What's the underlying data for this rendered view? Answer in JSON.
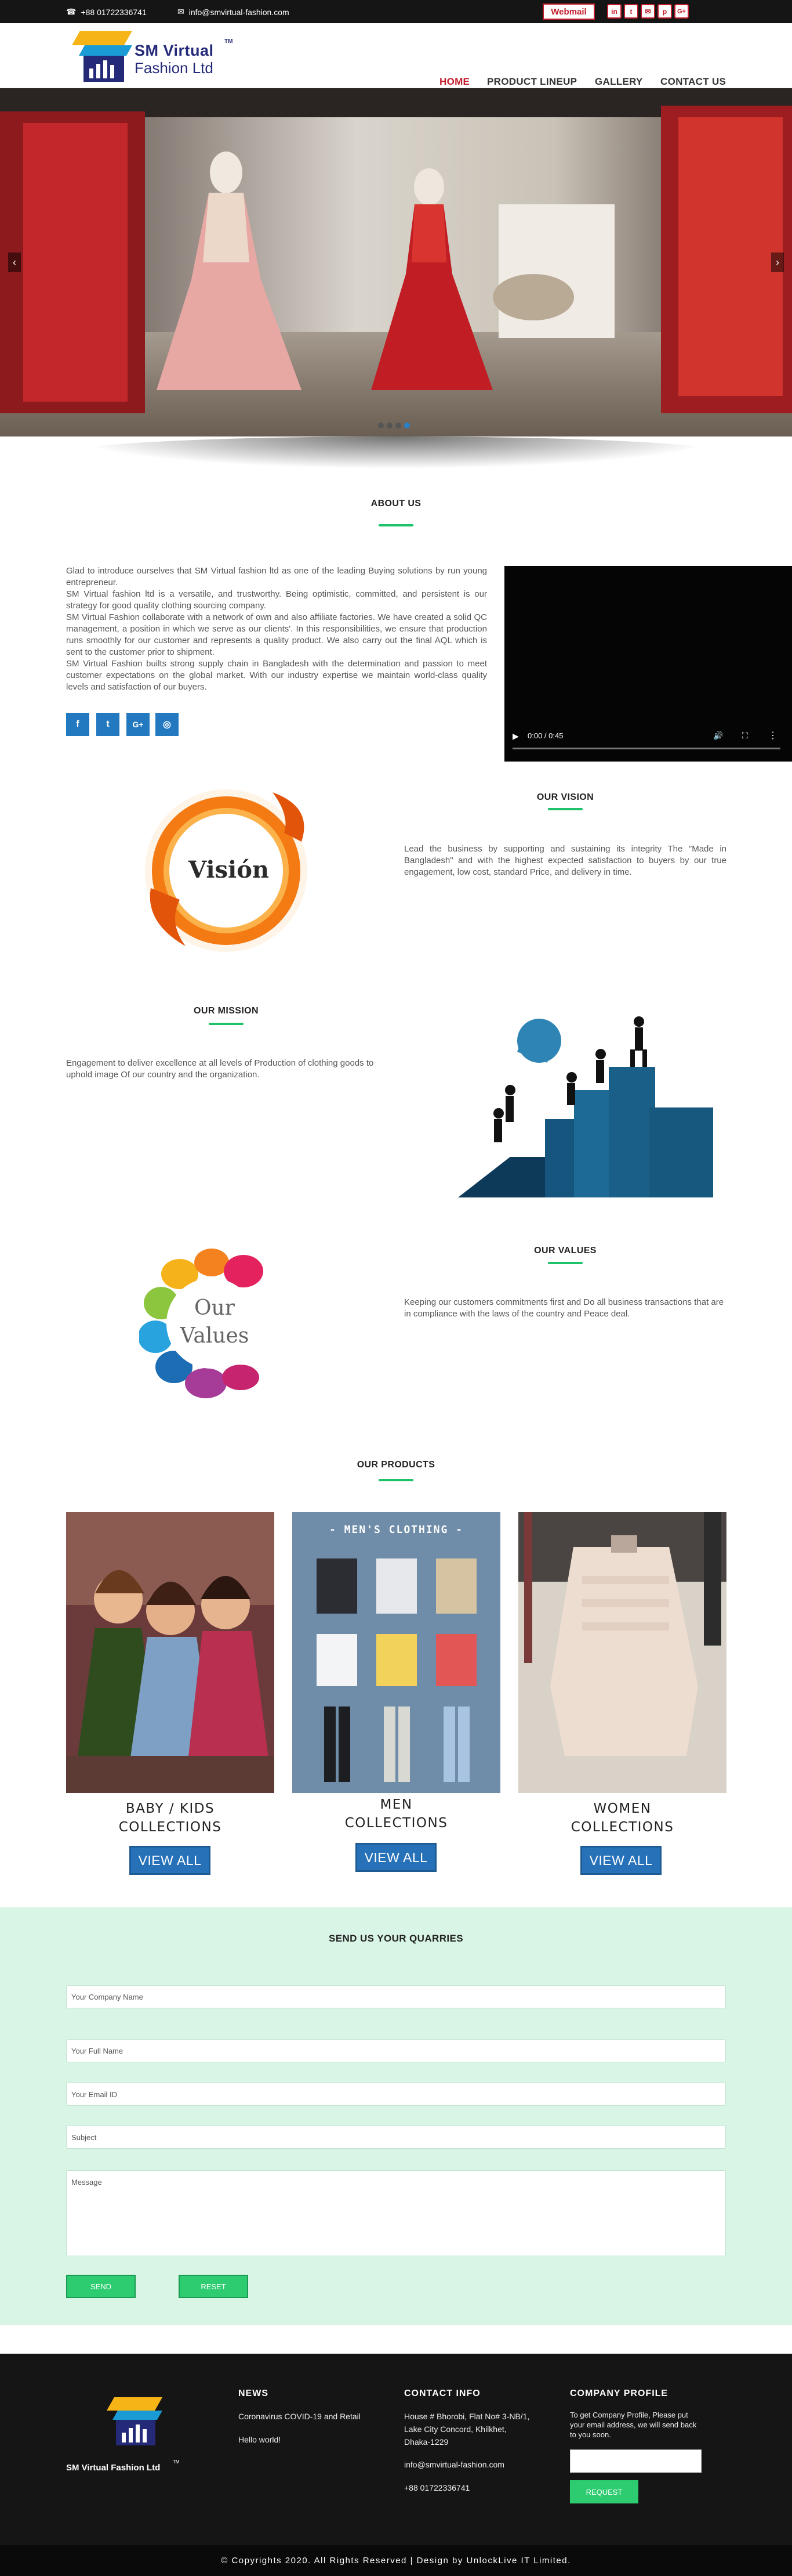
{
  "topbar": {
    "phone": "+88 01722336741",
    "email": "info@smvirtual-fashion.com",
    "webmail": "Webmail",
    "social": [
      "in",
      "t",
      "✉",
      "p",
      "G+"
    ]
  },
  "brand": {
    "name_line1": "SM Virtual",
    "name_line2": "Fashion Ltd",
    "tm": "TM"
  },
  "nav": [
    "HOME",
    "PRODUCT LINEUP",
    "GALLERY",
    "CONTACT US"
  ],
  "hero": {
    "dots": 4,
    "active_dot": 3
  },
  "about": {
    "title": "ABOUT US",
    "paragraphs": [
      "Glad to introduce ourselves  that SM Virtual fashion ltd as one of the leading Buying solutions by run young entrepreneur.",
      "SM Virtual fashion ltd is a versatile, and trustworthy. Being optimistic, committed, and persistent is our strategy for good quality clothing sourcing company.",
      "SM Virtual Fashion collaborate with a network of own and also affiliate factories. We have created a solid QC management, a position in which we serve as our clients'. In this responsibilities, we ensure that production runs smoothly for our customer and represents a quality product. We also carry out the final AQL which is sent to the customer prior to shipment.",
      "SM Virtual Fashion builts strong supply chain in Bangladesh with the determination and passion to meet customer expectations on the global market. With our industry expertise we maintain world-class quality levels and satisfaction of our buyers."
    ],
    "social": [
      "f",
      "t",
      "G+",
      "◎"
    ],
    "video_time": "0:00 / 0:45"
  },
  "vision": {
    "title": "OUR VISION",
    "logo_text": "Visión",
    "text": "Lead the business by supporting and sustaining its integrity The \"Made in Bangladesh\" and with the highest expected satisfaction to buyers by our true engagement, low cost, standard  Price, and delivery in time."
  },
  "mission": {
    "title": "OUR MISSION",
    "text": "Engagement to deliver excellence at all levels of Production of clothing goods to uphold image Of our country and the organization."
  },
  "values": {
    "title": "OUR VALUES",
    "logo_line1": "Our",
    "logo_line2": "Values",
    "text": "Keeping our customers commitments first and Do all business transactions that are in compliance with the laws of the country and Peace deal."
  },
  "products": {
    "title": "OUR PRODUCTS",
    "men_banner": "- MEN'S CLOTHING -",
    "items": [
      {
        "line1": "BABY / KIDS",
        "line2": "COLLECTIONS",
        "button": "VIEW ALL"
      },
      {
        "line1": "MEN",
        "line2": "COLLECTIONS",
        "button": "VIEW ALL"
      },
      {
        "line1": "WOMEN",
        "line2": "COLLECTIONS",
        "button": "VIEW ALL"
      }
    ]
  },
  "contact": {
    "title": "SEND US YOUR QUARRIES",
    "fields": [
      "Your Company Name",
      "Your Full Name",
      "Your Email ID",
      "Subject"
    ],
    "message": "Message",
    "send": "SEND",
    "reset": "RESET"
  },
  "footer": {
    "logo_text": "SM Virtual Fashion Ltd",
    "logo_tm": "TM",
    "news_title": "NEWS",
    "news": [
      "Coronavirus COVID-19 and Retail",
      "Hello world!"
    ],
    "contact_title": "CONTACT INFO",
    "address": [
      "House # Bhorobi, Flat No# 3-NB/1,",
      "Lake City Concord, Khilkhet,",
      "Dhaka-1229"
    ],
    "email": "info@smvirtual-fashion.com",
    "phone": "+88 01722336741",
    "profile_title": "COMPANY PROFILE",
    "profile_text": "To get Company Profile, Please put your email address, we will send back to you soon.",
    "request": "REQUEST",
    "copyright": "© Copyrights 2020. All Rights Reserved | Design by UnlockLive IT Limited."
  },
  "colors": {
    "accent": "#c21d2b",
    "green": "#1dc26a",
    "blue": "#2671b8",
    "footer": "#151515",
    "contact_bg": "#d8f5e6"
  }
}
